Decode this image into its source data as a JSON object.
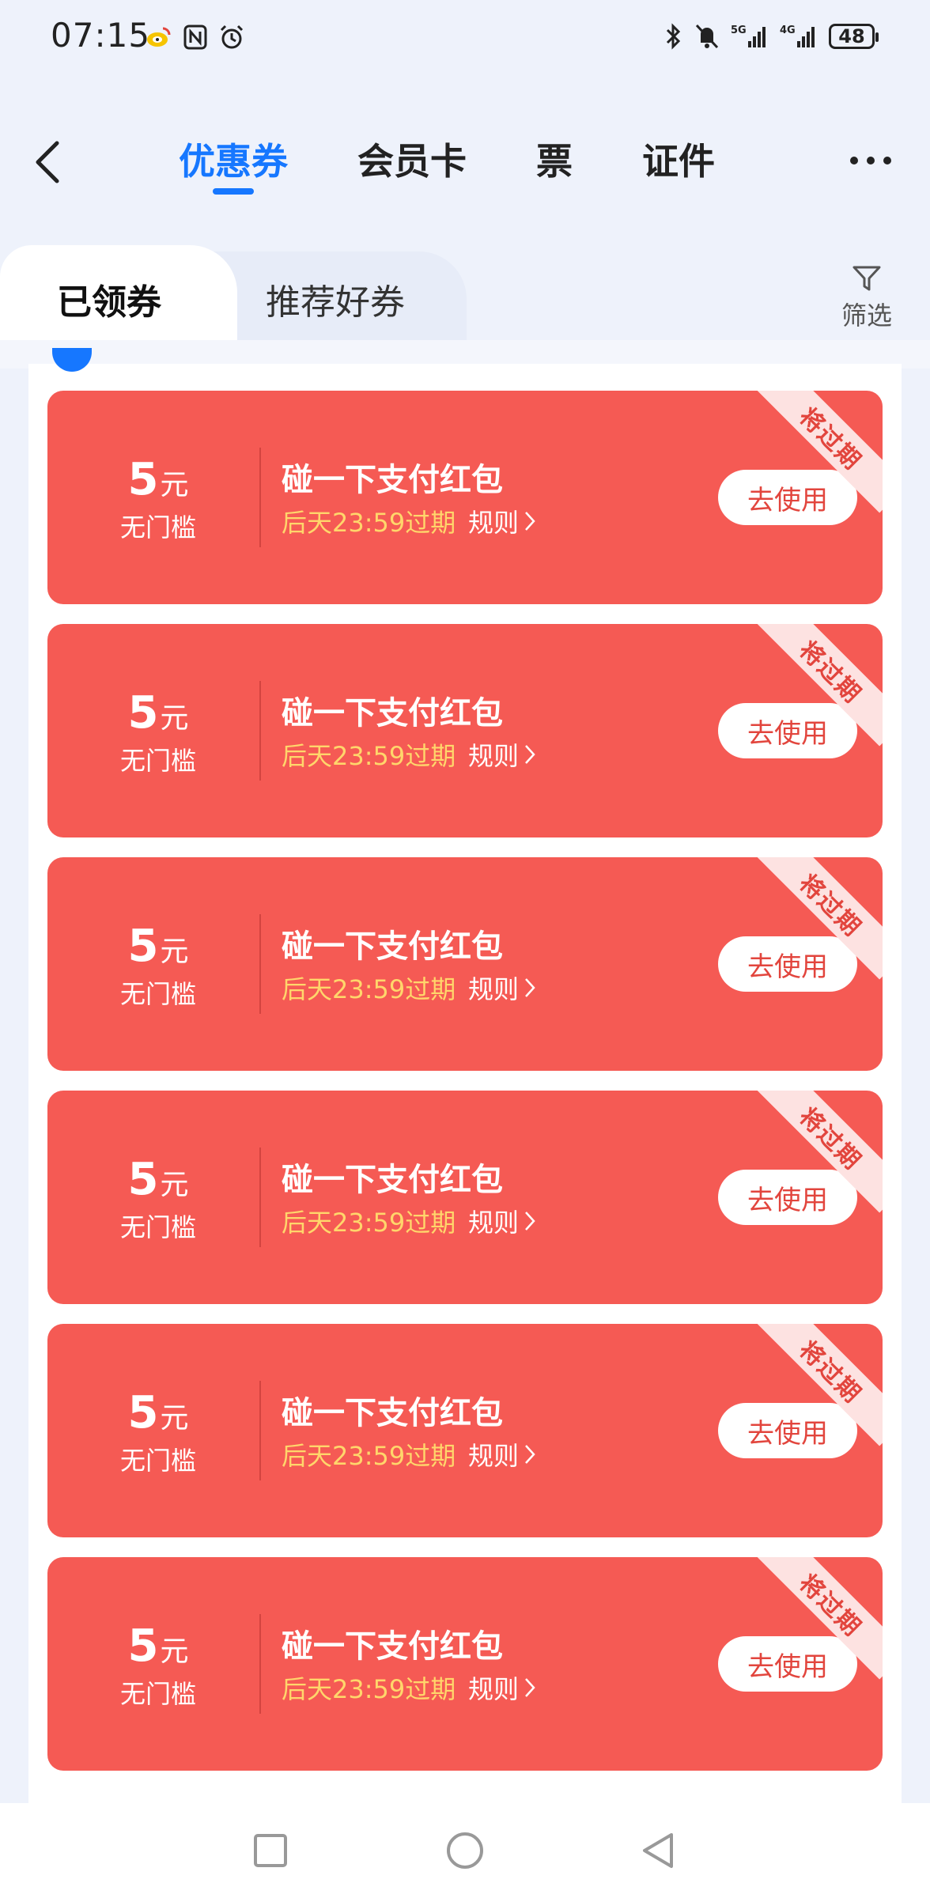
{
  "status_bar": {
    "time": "07:15",
    "left_icons": [
      "weibo-icon",
      "nfc-icon",
      "alarm-icon"
    ],
    "right_icons": [
      "bluetooth-icon",
      "mute-icon",
      "signal-5g-icon",
      "signal-4g-icon"
    ],
    "battery": "48"
  },
  "nav": {
    "tabs": [
      {
        "label": "优惠券",
        "active": true
      },
      {
        "label": "会员卡",
        "active": false
      },
      {
        "label": "票",
        "active": false
      },
      {
        "label": "证件",
        "active": false
      }
    ]
  },
  "sub_tabs": {
    "items": [
      {
        "label": "已领券",
        "active": true
      },
      {
        "label": "推荐好券",
        "active": false
      }
    ],
    "filter_label": "筛选"
  },
  "coupons": [
    {
      "amount": "5",
      "unit": "元",
      "threshold": "无门槛",
      "title": "碰一下支付红包",
      "expiry": "后天23:59过期",
      "rules": "规则",
      "action": "去使用",
      "badge": "将过期"
    },
    {
      "amount": "5",
      "unit": "元",
      "threshold": "无门槛",
      "title": "碰一下支付红包",
      "expiry": "后天23:59过期",
      "rules": "规则",
      "action": "去使用",
      "badge": "将过期"
    },
    {
      "amount": "5",
      "unit": "元",
      "threshold": "无门槛",
      "title": "碰一下支付红包",
      "expiry": "后天23:59过期",
      "rules": "规则",
      "action": "去使用",
      "badge": "将过期"
    },
    {
      "amount": "5",
      "unit": "元",
      "threshold": "无门槛",
      "title": "碰一下支付红包",
      "expiry": "后天23:59过期",
      "rules": "规则",
      "action": "去使用",
      "badge": "将过期"
    },
    {
      "amount": "5",
      "unit": "元",
      "threshold": "无门槛",
      "title": "碰一下支付红包",
      "expiry": "后天23:59过期",
      "rules": "规则",
      "action": "去使用",
      "badge": "将过期"
    },
    {
      "amount": "5",
      "unit": "元",
      "threshold": "无门槛",
      "title": "碰一下支付红包",
      "expiry": "后天23:59过期",
      "rules": "规则",
      "action": "去使用",
      "badge": "将过期"
    }
  ],
  "colors": {
    "accent": "#1677ff",
    "coupon_bg": "#f55a54",
    "expiry_text": "#ffd66b",
    "badge_bg": "#fde2e1"
  }
}
